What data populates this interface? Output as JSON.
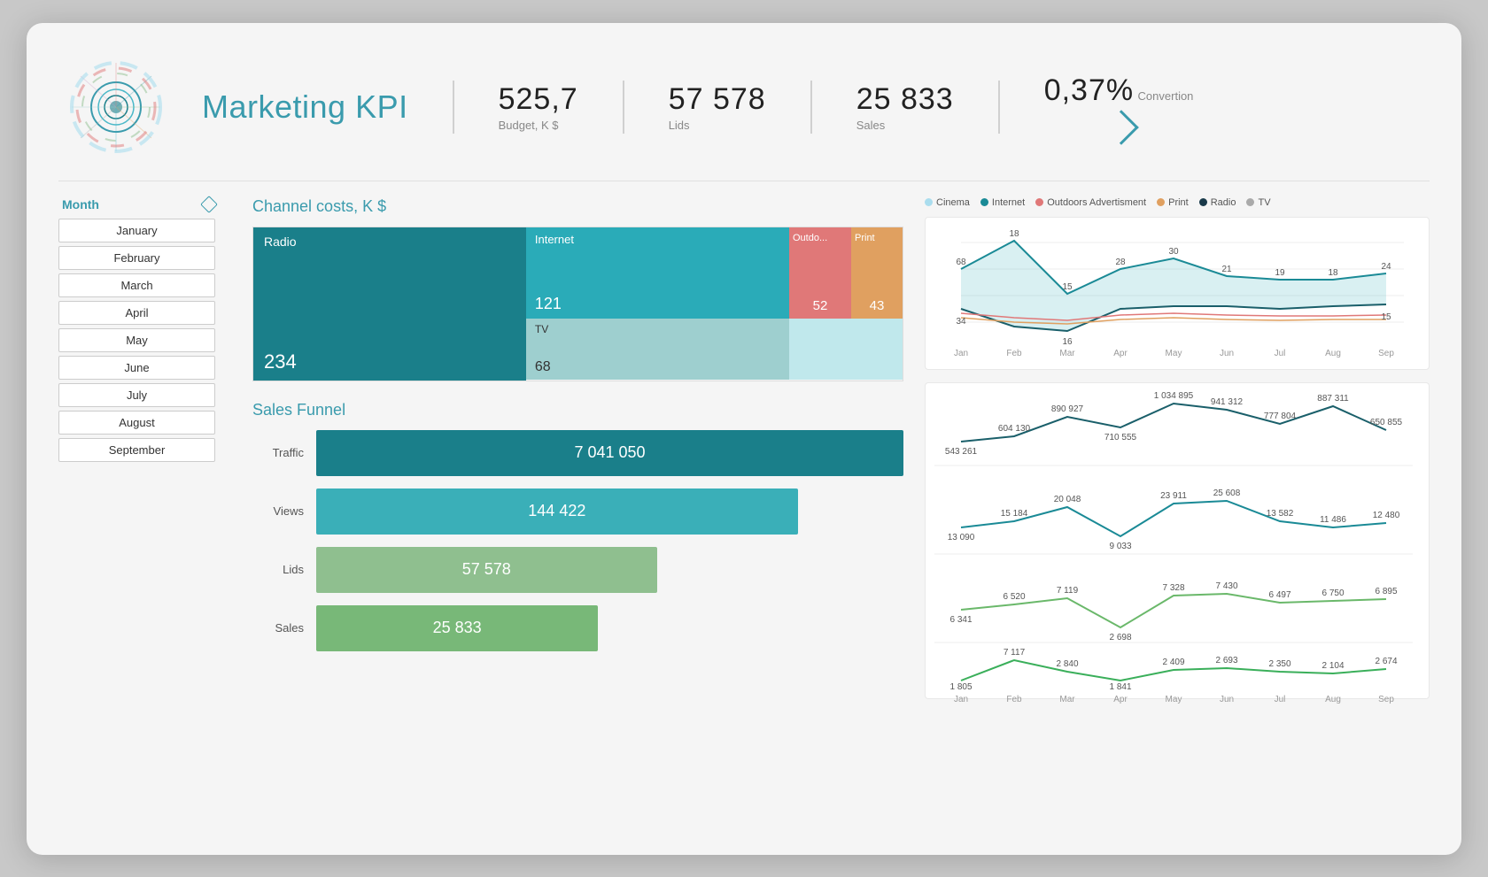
{
  "header": {
    "title": "Marketing KPI",
    "kpis": [
      {
        "value": "525,7",
        "label": "Budget, K $"
      },
      {
        "value": "57 578",
        "label": "Lids"
      },
      {
        "value": "25 833",
        "label": "Sales"
      },
      {
        "value": "0,37%",
        "label": "Convertion"
      }
    ]
  },
  "sidebar": {
    "month_header": "Month",
    "months": [
      "January",
      "February",
      "March",
      "April",
      "May",
      "June",
      "July",
      "August",
      "September"
    ]
  },
  "channel_costs": {
    "title": "Channel costs, K $",
    "segments": [
      {
        "name": "Radio",
        "value": "234",
        "color": "#1a7f8a"
      },
      {
        "name": "Internet",
        "value": "121",
        "color": "#2aabb8"
      },
      {
        "name": "Outdoors",
        "value": "52",
        "color": "#e07878"
      },
      {
        "name": "Print",
        "value": "43",
        "color": "#e0a060"
      },
      {
        "name": "TV",
        "value": "68",
        "color": "#9ecfcf"
      }
    ]
  },
  "sales_funnel": {
    "title": "Sales Funnel",
    "rows": [
      {
        "label": "Traffic",
        "value": "7 041 050",
        "color": "#1a7f8a",
        "width_pct": 100
      },
      {
        "label": "Views",
        "value": "144 422",
        "color": "#3aafb8",
        "width_pct": 82
      },
      {
        "label": "Lids",
        "value": "57 578",
        "color": "#8fbf8f",
        "width_pct": 58
      },
      {
        "label": "Sales",
        "value": "25 833",
        "color": "#78b878",
        "width_pct": 48
      }
    ]
  },
  "legend": [
    {
      "name": "Cinema",
      "color": "#aaddee"
    },
    {
      "name": "Internet",
      "color": "#1a8a96"
    },
    {
      "name": "Outdoors Advertisment",
      "color": "#e07878"
    },
    {
      "name": "Print",
      "color": "#e0a060"
    },
    {
      "name": "Radio",
      "color": "#1a3a4a"
    },
    {
      "name": "TV",
      "color": "#aaaaaa"
    }
  ],
  "top_chart": {
    "months": [
      "Jan",
      "Feb",
      "Mar",
      "Apr",
      "May",
      "Jun",
      "Jul",
      "Aug",
      "Sep"
    ],
    "series": {
      "teal_upper": [
        68,
        18,
        15,
        28,
        30,
        21,
        19,
        18,
        24
      ],
      "teal_lower": [
        34,
        0,
        16,
        0,
        0,
        0,
        0,
        0,
        15
      ],
      "salmon": [
        10,
        8,
        6,
        7,
        8,
        7,
        7,
        7,
        7
      ],
      "orange": [
        8,
        6,
        5,
        6,
        7,
        6,
        6,
        6,
        6
      ]
    }
  },
  "funnel_charts": {
    "months": [
      "Jan",
      "Feb",
      "Mar",
      "Apr",
      "May",
      "Jun",
      "Jul",
      "Aug",
      "Sep"
    ],
    "traffic": [
      543261,
      604130,
      890927,
      710555,
      1034895,
      941312,
      777804,
      887311,
      650855
    ],
    "views": [
      13090,
      15184,
      20048,
      9033,
      23911,
      25608,
      13582,
      11486,
      12480
    ],
    "lids": [
      6341,
      6520,
      7119,
      2698,
      7328,
      7430,
      6497,
      6750,
      6895
    ],
    "sales": [
      1805,
      7117,
      2840,
      1841,
      2409,
      2693,
      2350,
      2104,
      2674
    ]
  }
}
